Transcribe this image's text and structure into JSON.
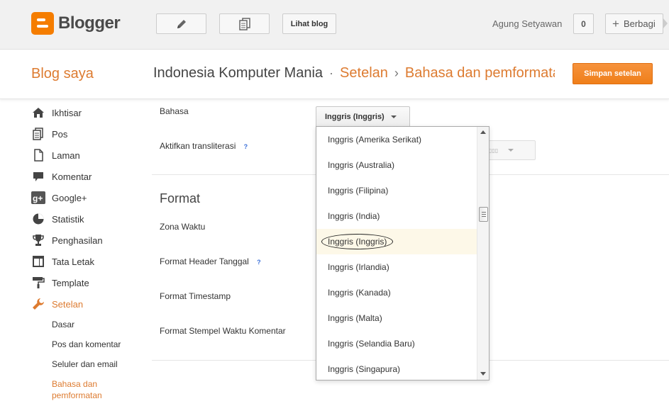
{
  "topbar": {
    "logo_text": "Blogger",
    "view_blog_label": "Lihat blog",
    "username": "Agung Setyawan",
    "notification_count": "0",
    "share_label": "Berbagi",
    "icons": [
      "pencil-icon",
      "pages-icon",
      "plus-icon"
    ]
  },
  "header": {
    "my_blogs": "Blog saya",
    "blog_name": "Indonesia Komputer Mania",
    "sep1": "·",
    "crumb_settings": "Setelan",
    "sep2": "›",
    "crumb_page": "Bahasa dan pemformatan",
    "save_label": "Simpan setelan"
  },
  "sidebar": {
    "items": [
      {
        "label": "Ikhtisar",
        "icon": "home-icon"
      },
      {
        "label": "Pos",
        "icon": "posts-icon"
      },
      {
        "label": "Laman",
        "icon": "pages-icon"
      },
      {
        "label": "Komentar",
        "icon": "comment-icon"
      },
      {
        "label": "Google+",
        "icon": "google-plus-icon"
      },
      {
        "label": "Statistik",
        "icon": "pie-chart-icon"
      },
      {
        "label": "Penghasilan",
        "icon": "trophy-icon"
      },
      {
        "label": "Tata Letak",
        "icon": "layout-icon"
      },
      {
        "label": "Template",
        "icon": "paint-roller-icon"
      },
      {
        "label": "Setelan",
        "icon": "wrench-icon"
      }
    ],
    "subitems": [
      {
        "label": "Dasar"
      },
      {
        "label": "Pos dan komentar"
      },
      {
        "label": "Seluler dan email"
      },
      {
        "label": "Bahasa dan pemformatan"
      }
    ]
  },
  "main": {
    "language_label": "Bahasa",
    "language_value": "Inggris (Inggris)",
    "transliteration_label": "Aktifkan transliterasi",
    "help_glyph": "?",
    "format_heading": "Format",
    "timezone_label": "Zona Waktu",
    "date_header_format_label": "Format Header Tanggal",
    "timestamp_format_label": "Format Timestamp",
    "comment_timestamp_label": "Format Stempel Waktu Komentar"
  },
  "dropdown": {
    "options": [
      "Inggris (Amerika Serikat)",
      "Inggris (Australia)",
      "Inggris (Filipina)",
      "Inggris (India)",
      "Inggris (Inggris)",
      "Inggris (Irlandia)",
      "Inggris (Kanada)",
      "Inggris (Malta)",
      "Inggris (Selandia Baru)",
      "Inggris (Singapura)"
    ],
    "selected_index": 4
  },
  "colors": {
    "accent_orange": "#dd7b30",
    "save_button": "#f18a2a",
    "logo_orange": "#f57d00"
  }
}
